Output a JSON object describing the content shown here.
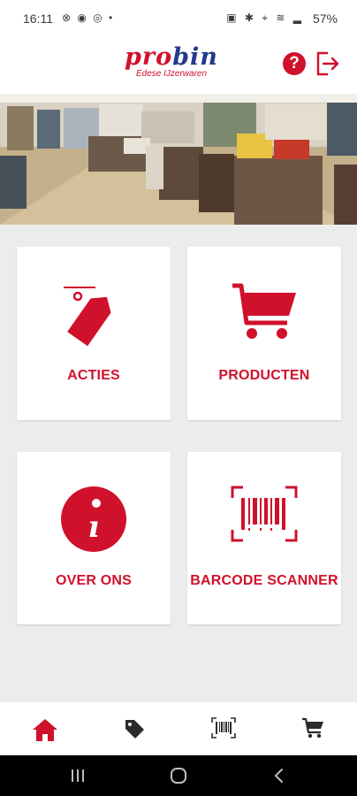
{
  "status_bar": {
    "time": "16:11",
    "left_icons": "⊗ ◉ ◎ •",
    "right_icons": "▣ ✱ ⌖ ≋ ▂",
    "battery": "57%"
  },
  "header": {
    "brand_pro": "pro",
    "brand_bin": "bin",
    "tagline": "Edese IJzerwaren",
    "help_label": "?"
  },
  "tiles": [
    {
      "label": "ACTIES",
      "icon": "tag-icon"
    },
    {
      "label": "PRODUCTEN",
      "icon": "cart-icon"
    },
    {
      "label": "OVER ONS",
      "icon": "info-icon"
    },
    {
      "label": "BARCODE SCANNER",
      "icon": "barcode-icon"
    }
  ],
  "bottom_nav": [
    {
      "icon": "home-icon",
      "active": true
    },
    {
      "icon": "tag-icon",
      "active": false
    },
    {
      "icon": "barcode-icon",
      "active": false
    },
    {
      "icon": "cart-icon",
      "active": false
    }
  ],
  "colors": {
    "brand_red": "#d0112b",
    "brand_blue": "#243a8a",
    "background": "#ececec",
    "nav_icon": "#2b2b2b"
  }
}
